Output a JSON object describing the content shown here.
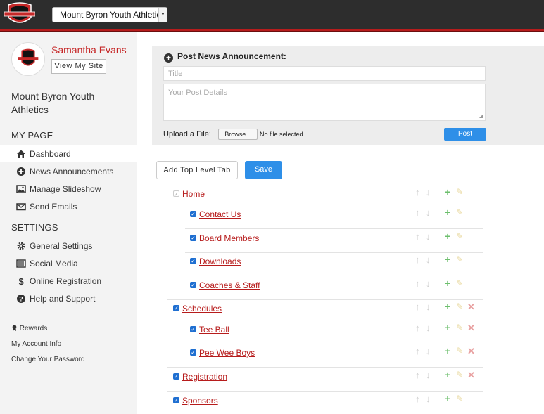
{
  "header": {
    "org_select_value": "Mount Byron Youth Athletics",
    "logo_text": "JERSEY WATCH NETWORK"
  },
  "profile": {
    "name": "Samantha Evans",
    "view_site_label": "View My Site"
  },
  "sidebar": {
    "org_name": "Mount Byron Youth Athletics",
    "my_page_heading": "MY PAGE",
    "my_page_items": [
      {
        "label": "Dashboard",
        "icon": "home-icon"
      },
      {
        "label": "News Announcements",
        "icon": "plus-circle-icon"
      },
      {
        "label": "Manage Slideshow",
        "icon": "image-icon"
      },
      {
        "label": "Send Emails",
        "icon": "envelope-icon"
      }
    ],
    "settings_heading": "SETTINGS",
    "settings_items": [
      {
        "label": "General Settings",
        "icon": "gear-icon"
      },
      {
        "label": "Social Media",
        "icon": "list-icon"
      },
      {
        "label": "Online Registration",
        "icon": "dollar-icon"
      },
      {
        "label": "Help and Support",
        "icon": "question-circle-icon"
      }
    ],
    "small_links": {
      "rewards": "Rewards",
      "account": "My Account Info",
      "password": "Change Your Password"
    }
  },
  "post": {
    "heading": "Post News Announcement:",
    "title_placeholder": "Title",
    "details_placeholder": "Your Post Details",
    "upload_label": "Upload a File:",
    "browse_label": "Browse...",
    "no_file_text": "No file selected.",
    "post_label": "Post"
  },
  "toolbar": {
    "add_tab_label": "Add Top Level Tab",
    "save_label": "Save"
  },
  "tabs": [
    {
      "label": "Home",
      "level": 0,
      "checked": true,
      "checkbox_style": "grey",
      "delete": false
    },
    {
      "label": "Contact Us",
      "level": 1,
      "checked": true,
      "delete": false
    },
    {
      "label": "Board Members",
      "level": 1,
      "checked": true,
      "delete": false
    },
    {
      "label": "Downloads",
      "level": 1,
      "checked": true,
      "delete": false
    },
    {
      "label": "Coaches & Staff",
      "level": 1,
      "checked": true,
      "delete": false
    },
    {
      "label": "Schedules",
      "level": 0,
      "checked": true,
      "delete": true
    },
    {
      "label": "Tee Ball",
      "level": 1,
      "checked": true,
      "delete": true
    },
    {
      "label": "Pee Wee Boys",
      "level": 1,
      "checked": true,
      "delete": true
    },
    {
      "label": "Registration",
      "level": 0,
      "checked": true,
      "delete": true
    },
    {
      "label": "Sponsors",
      "level": 0,
      "checked": true,
      "delete": false
    }
  ],
  "colors": {
    "accent_red": "#b71c1c",
    "button_blue": "#2e8fe8",
    "checkbox_blue": "#1f6fd1"
  }
}
